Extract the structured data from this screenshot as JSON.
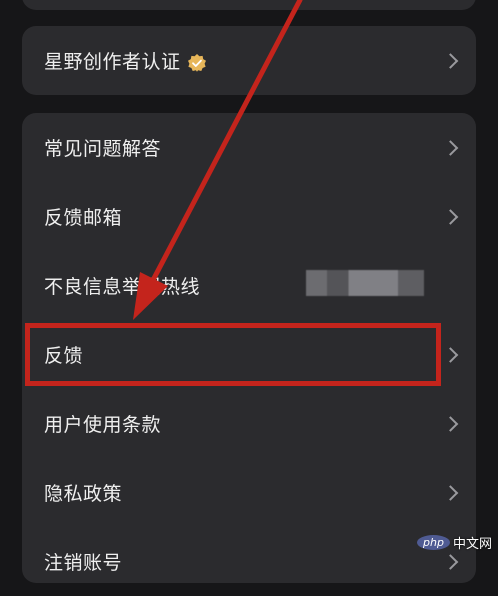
{
  "creator_card": {
    "label": "星野创作者认证",
    "badge_icon": "verified-badge-icon",
    "badge_color": "#e7b65a"
  },
  "menu": {
    "items": [
      {
        "label": "常见问题解答"
      },
      {
        "label": "反馈邮箱"
      },
      {
        "label": "不良信息举报热线"
      },
      {
        "label": "反馈"
      },
      {
        "label": "用户使用条款"
      },
      {
        "label": "隐私政策"
      },
      {
        "label": "注销账号"
      }
    ]
  },
  "annotation": {
    "color": "#c4241c",
    "highlighted_item": "反馈"
  },
  "watermark": {
    "logo_text": "php",
    "site_text": "中文网"
  }
}
